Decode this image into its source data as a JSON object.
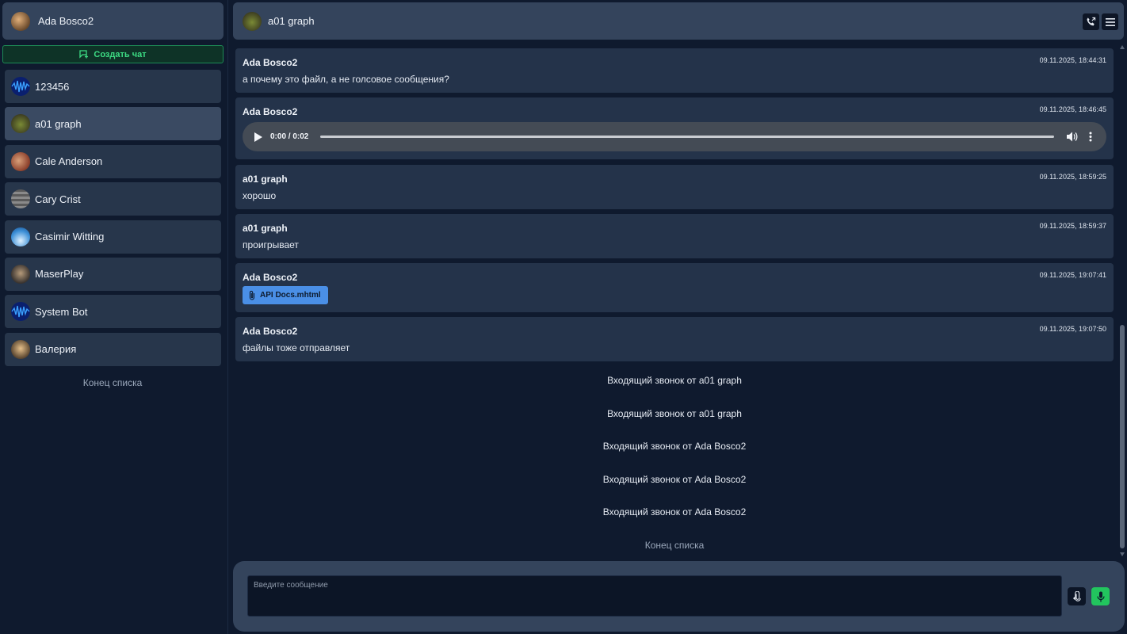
{
  "sidebar": {
    "profile_name": "Ada Bosco2",
    "create_chat_label": "Создать чат",
    "chats": [
      {
        "label": "123456",
        "avatar": "wave"
      },
      {
        "label": "a01 graph",
        "avatar": "turtle"
      },
      {
        "label": "Cale Anderson",
        "avatar": "red"
      },
      {
        "label": "Cary Crist",
        "avatar": "stripes"
      },
      {
        "label": "Casimir Witting",
        "avatar": "sky"
      },
      {
        "label": "MaserPlay",
        "avatar": "dark"
      },
      {
        "label": "System Bot",
        "avatar": "wave"
      },
      {
        "label": "Валерия",
        "avatar": "tiger"
      }
    ],
    "end_of_list": "Конец списка"
  },
  "header": {
    "title": "a01 graph"
  },
  "messages": [
    {
      "author": "Ada Bosco2",
      "time": "09.11.2025, 18:44:31",
      "text": "а почему это файл, а не голсовое сообщения?"
    },
    {
      "author": "Ada Bosco2",
      "time": "09.11.2025, 18:46:45",
      "audio_time": "0:00 / 0:02"
    },
    {
      "author": "a01 graph",
      "time": "09.11.2025, 18:59:25",
      "text": "хорошо"
    },
    {
      "author": "a01 graph",
      "time": "09.11.2025, 18:59:37",
      "text": "проигрывает"
    },
    {
      "author": "Ada Bosco2",
      "time": "09.11.2025, 19:07:41",
      "file": "API Docs.mhtml"
    },
    {
      "author": "Ada Bosco2",
      "time": "09.11.2025, 19:07:50",
      "text": "файлы тоже отправляет"
    }
  ],
  "system_events": [
    "Входящий звонок от a01 graph",
    "Входящий звонок от a01 graph",
    "Входящий звонок от Ada Bosco2",
    "Входящий звонок от Ada Bosco2",
    "Входящий звонок от Ada Bosco2"
  ],
  "end_of_list": "Конец списка",
  "composer": {
    "placeholder": "Введите сообщение",
    "value": ""
  },
  "colors": {
    "background": "#0f1a2e",
    "panel": "#34445c",
    "message": "#24334a",
    "accent_green": "#22c55e",
    "file_blue": "#4a8fe6"
  },
  "icons": [
    "create-chat-icon",
    "call-icon",
    "menu-icon",
    "play-icon",
    "volume-icon",
    "more-vertical-icon",
    "paperclip-icon",
    "attach-icon",
    "microphone-icon"
  ]
}
